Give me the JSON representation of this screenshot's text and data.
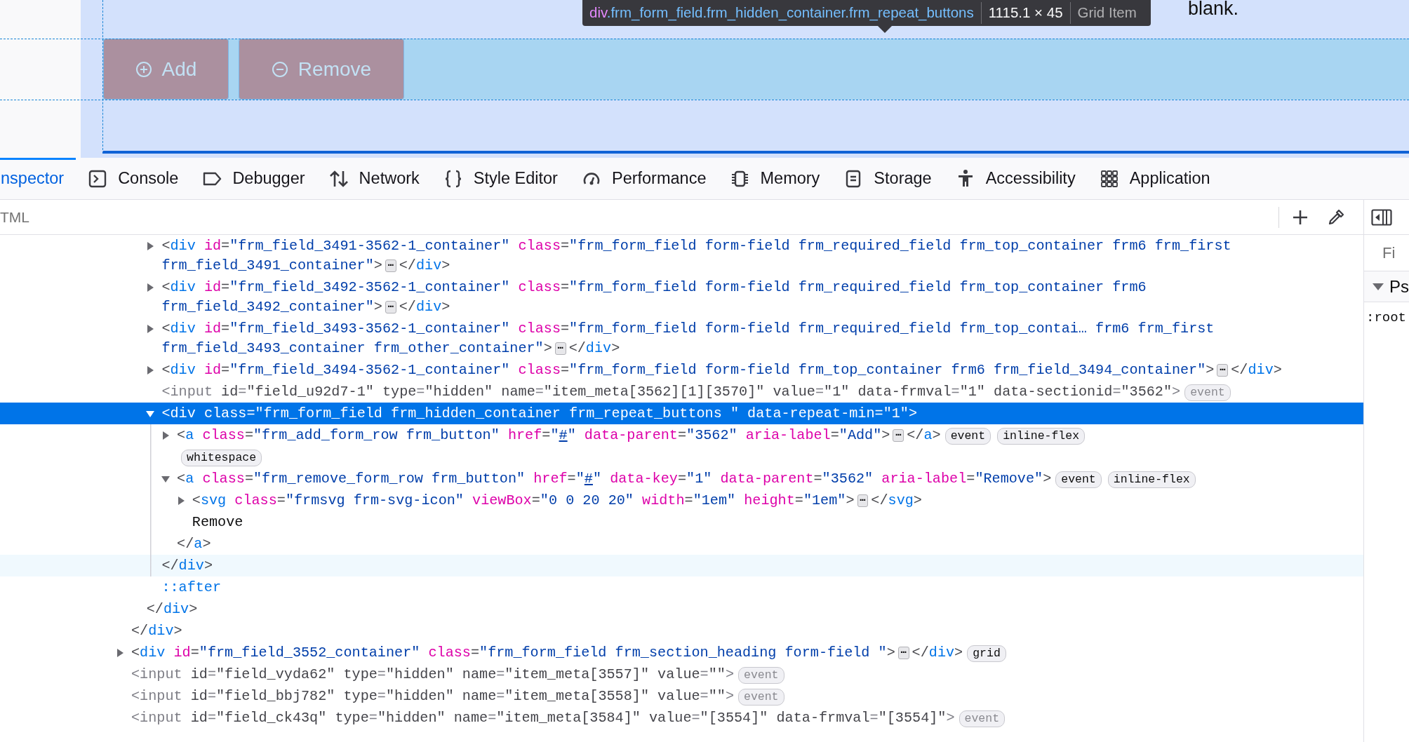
{
  "page": {
    "buttons": [
      {
        "kind": "plus",
        "label": "Add"
      },
      {
        "kind": "minus",
        "label": "Remove"
      }
    ],
    "trailing_text": "blank."
  },
  "tooltip": {
    "tag": "div",
    "classes": ".frm_form_field.frm_hidden_container.frm_repeat_buttons",
    "size": "1115.1 × 45",
    "layout": "Grid Item"
  },
  "toolbar": {
    "tabs": [
      {
        "kind": "inspector",
        "label": "nspector",
        "selected": true
      },
      {
        "kind": "console",
        "label": "Console",
        "selected": false
      },
      {
        "kind": "debugger",
        "label": "Debugger",
        "selected": false
      },
      {
        "kind": "network",
        "label": "Network",
        "selected": false
      },
      {
        "kind": "style",
        "label": "Style Editor",
        "selected": false
      },
      {
        "kind": "performance",
        "label": "Performance",
        "selected": false
      },
      {
        "kind": "memory",
        "label": "Memory",
        "selected": false
      },
      {
        "kind": "storage",
        "label": "Storage",
        "selected": false
      },
      {
        "kind": "accessibility",
        "label": "Accessibility",
        "selected": false
      },
      {
        "kind": "application",
        "label": "Application",
        "selected": false
      }
    ]
  },
  "search": {
    "placeholder": "TML"
  },
  "markup": {
    "nodes": [
      {
        "children": [
          {
            "children": [
              {
                "selected": false,
                "hovered": false,
                "hidden": false,
                "expanded": false,
                "tokens": [
                  {
                    "kind": "punct",
                    "text": "<"
                  },
                  {
                    "kind": "tag",
                    "text": "div"
                  },
                  {
                    "kind": "attr",
                    "text": " id"
                  },
                  {
                    "kind": "punct",
                    "text": "="
                  },
                  {
                    "kind": "value",
                    "text": "\"frm_field_3491-3562-1_container\""
                  },
                  {
                    "kind": "attr",
                    "text": " class"
                  },
                  {
                    "kind": "punct",
                    "text": "="
                  },
                  {
                    "kind": "value",
                    "text": "\"frm_form_field form-field frm_required_field frm_top_container frm6 frm_first frm_field_3491_container\""
                  },
                  {
                    "kind": "punct",
                    "text": ">"
                  },
                  {
                    "kind": "more",
                    "text": "⋯"
                  },
                  {
                    "kind": "punct",
                    "text": "</"
                  },
                  {
                    "kind": "tag",
                    "text": "div"
                  },
                  {
                    "kind": "punct",
                    "text": ">"
                  }
                ]
              },
              {
                "selected": false,
                "hovered": false,
                "hidden": false,
                "expanded": false,
                "tokens": [
                  {
                    "kind": "punct",
                    "text": "<"
                  },
                  {
                    "kind": "tag",
                    "text": "div"
                  },
                  {
                    "kind": "attr",
                    "text": " id"
                  },
                  {
                    "kind": "punct",
                    "text": "="
                  },
                  {
                    "kind": "value",
                    "text": "\"frm_field_3492-3562-1_container\""
                  },
                  {
                    "kind": "attr",
                    "text": " class"
                  },
                  {
                    "kind": "punct",
                    "text": "="
                  },
                  {
                    "kind": "value",
                    "text": "\"frm_form_field form-field frm_required_field frm_top_container frm6 frm_field_3492_container\""
                  },
                  {
                    "kind": "punct",
                    "text": ">"
                  },
                  {
                    "kind": "more",
                    "text": "⋯"
                  },
                  {
                    "kind": "punct",
                    "text": "</"
                  },
                  {
                    "kind": "tag",
                    "text": "div"
                  },
                  {
                    "kind": "punct",
                    "text": ">"
                  }
                ]
              },
              {
                "selected": false,
                "hovered": false,
                "hidden": false,
                "expanded": false,
                "tokens": [
                  {
                    "kind": "punct",
                    "text": "<"
                  },
                  {
                    "kind": "tag",
                    "text": "div"
                  },
                  {
                    "kind": "attr",
                    "text": " id"
                  },
                  {
                    "kind": "punct",
                    "text": "="
                  },
                  {
                    "kind": "value",
                    "text": "\"frm_field_3493-3562-1_container\""
                  },
                  {
                    "kind": "attr",
                    "text": " class"
                  },
                  {
                    "kind": "punct",
                    "text": "="
                  },
                  {
                    "kind": "value",
                    "text": "\"frm_form_field form-field frm_required_field frm_top_contai… frm6 frm_first frm_field_3493_container frm_other_container\""
                  },
                  {
                    "kind": "punct",
                    "text": ">"
                  },
                  {
                    "kind": "more",
                    "text": "⋯"
                  },
                  {
                    "kind": "punct",
                    "text": "</"
                  },
                  {
                    "kind": "tag",
                    "text": "div"
                  },
                  {
                    "kind": "punct",
                    "text": ">"
                  }
                ]
              },
              {
                "selected": false,
                "hovered": false,
                "hidden": false,
                "expanded": false,
                "tokens": [
                  {
                    "kind": "punct",
                    "text": "<"
                  },
                  {
                    "kind": "tag",
                    "text": "div"
                  },
                  {
                    "kind": "attr",
                    "text": " id"
                  },
                  {
                    "kind": "punct",
                    "text": "="
                  },
                  {
                    "kind": "value",
                    "text": "\"frm_field_3494-3562-1_container\""
                  },
                  {
                    "kind": "attr",
                    "text": " class"
                  },
                  {
                    "kind": "punct",
                    "text": "="
                  },
                  {
                    "kind": "value",
                    "text": "\"frm_form_field form-field frm_top_container frm6 frm_field_3494_container\""
                  },
                  {
                    "kind": "punct",
                    "text": ">"
                  },
                  {
                    "kind": "more",
                    "text": "⋯"
                  },
                  {
                    "kind": "punct",
                    "text": "</"
                  },
                  {
                    "kind": "tag",
                    "text": "div"
                  },
                  {
                    "kind": "punct",
                    "text": ">"
                  }
                ]
              },
              {
                "selected": false,
                "hovered": false,
                "hidden": true,
                "tokens": [
                  {
                    "kind": "punct",
                    "text": "<"
                  },
                  {
                    "kind": "tag",
                    "text": "input"
                  },
                  {
                    "kind": "attr",
                    "text": " id"
                  },
                  {
                    "kind": "punct",
                    "text": "="
                  },
                  {
                    "kind": "value",
                    "text": "\"field_u92d7-1\""
                  },
                  {
                    "kind": "attr",
                    "text": " type"
                  },
                  {
                    "kind": "punct",
                    "text": "="
                  },
                  {
                    "kind": "value",
                    "text": "\"hidden\""
                  },
                  {
                    "kind": "attr",
                    "text": " name"
                  },
                  {
                    "kind": "punct",
                    "text": "="
                  },
                  {
                    "kind": "value",
                    "text": "\"item_meta[3562][1][3570]\""
                  },
                  {
                    "kind": "attr",
                    "text": " value"
                  },
                  {
                    "kind": "punct",
                    "text": "="
                  },
                  {
                    "kind": "value",
                    "text": "\"1\""
                  },
                  {
                    "kind": "attr",
                    "text": " data-frmval"
                  },
                  {
                    "kind": "punct",
                    "text": "="
                  },
                  {
                    "kind": "value",
                    "text": "\"1\""
                  },
                  {
                    "kind": "attr",
                    "text": " data-sectionid"
                  },
                  {
                    "kind": "punct",
                    "text": "="
                  },
                  {
                    "kind": "value",
                    "text": "\"3562\""
                  },
                  {
                    "kind": "punct",
                    "text": ">"
                  },
                  {
                    "kind": "badge",
                    "text": "event"
                  }
                ]
              },
              {
                "selected": true,
                "hovered": false,
                "hidden": false,
                "expanded": true,
                "tokens": [
                  {
                    "kind": "punct",
                    "text": "<"
                  },
                  {
                    "kind": "tag",
                    "text": "div"
                  },
                  {
                    "kind": "attr",
                    "text": " class"
                  },
                  {
                    "kind": "punct",
                    "text": "="
                  },
                  {
                    "kind": "value",
                    "text": "\"frm_form_field frm_hidden_container frm_repeat_buttons \""
                  },
                  {
                    "kind": "attr",
                    "text": " data-repeat-min"
                  },
                  {
                    "kind": "punct",
                    "text": "="
                  },
                  {
                    "kind": "value",
                    "text": "\"1\""
                  },
                  {
                    "kind": "punct",
                    "text": ">"
                  }
                ],
                "children": [
                  {
                    "selected": false,
                    "hovered": false,
                    "hidden": false,
                    "expanded": false,
                    "tokens": [
                      {
                        "kind": "punct",
                        "text": "<"
                      },
                      {
                        "kind": "tag",
                        "text": "a"
                      },
                      {
                        "kind": "attr",
                        "text": " class"
                      },
                      {
                        "kind": "punct",
                        "text": "="
                      },
                      {
                        "kind": "value",
                        "text": "\"frm_add_form_row frm_button\""
                      },
                      {
                        "kind": "attr",
                        "text": " href"
                      },
                      {
                        "kind": "punct",
                        "text": "="
                      },
                      {
                        "kind": "value",
                        "text": "\""
                      },
                      {
                        "kind": "link",
                        "text": "#"
                      },
                      {
                        "kind": "value",
                        "text": "\""
                      },
                      {
                        "kind": "attr",
                        "text": " data-parent"
                      },
                      {
                        "kind": "punct",
                        "text": "="
                      },
                      {
                        "kind": "value",
                        "text": "\"3562\""
                      },
                      {
                        "kind": "attr",
                        "text": " aria-label"
                      },
                      {
                        "kind": "punct",
                        "text": "="
                      },
                      {
                        "kind": "value",
                        "text": "\"Add\""
                      },
                      {
                        "kind": "punct",
                        "text": ">"
                      },
                      {
                        "kind": "more",
                        "text": "⋯"
                      },
                      {
                        "kind": "punct",
                        "text": "</"
                      },
                      {
                        "kind": "tag",
                        "text": "a"
                      },
                      {
                        "kind": "punct",
                        "text": ">"
                      },
                      {
                        "kind": "badge",
                        "text": "event"
                      },
                      {
                        "kind": "badge",
                        "text": "inline-flex"
                      }
                    ]
                  },
                  {
                    "selected": false,
                    "hovered": false,
                    "hidden": false,
                    "tokens": [
                      {
                        "kind": "badge",
                        "text": "whitespace"
                      }
                    ]
                  },
                  {
                    "selected": false,
                    "hovered": false,
                    "hidden": false,
                    "expanded": true,
                    "tokens": [
                      {
                        "kind": "punct",
                        "text": "<"
                      },
                      {
                        "kind": "tag",
                        "text": "a"
                      },
                      {
                        "kind": "attr",
                        "text": " class"
                      },
                      {
                        "kind": "punct",
                        "text": "="
                      },
                      {
                        "kind": "value",
                        "text": "\"frm_remove_form_row frm_button\""
                      },
                      {
                        "kind": "attr",
                        "text": " href"
                      },
                      {
                        "kind": "punct",
                        "text": "="
                      },
                      {
                        "kind": "value",
                        "text": "\""
                      },
                      {
                        "kind": "link",
                        "text": "#"
                      },
                      {
                        "kind": "value",
                        "text": "\""
                      },
                      {
                        "kind": "attr",
                        "text": " data-key"
                      },
                      {
                        "kind": "punct",
                        "text": "="
                      },
                      {
                        "kind": "value",
                        "text": "\"1\""
                      },
                      {
                        "kind": "attr",
                        "text": " data-parent"
                      },
                      {
                        "kind": "punct",
                        "text": "="
                      },
                      {
                        "kind": "value",
                        "text": "\"3562\""
                      },
                      {
                        "kind": "attr",
                        "text": " aria-label"
                      },
                      {
                        "kind": "punct",
                        "text": "="
                      },
                      {
                        "kind": "value",
                        "text": "\"Remove\""
                      },
                      {
                        "kind": "punct",
                        "text": ">"
                      },
                      {
                        "kind": "badge",
                        "text": "event"
                      },
                      {
                        "kind": "badge",
                        "text": "inline-flex"
                      }
                    ],
                    "children": [
                      {
                        "selected": false,
                        "hovered": false,
                        "hidden": false,
                        "expanded": false,
                        "tokens": [
                          {
                            "kind": "punct",
                            "text": "<"
                          },
                          {
                            "kind": "tag",
                            "text": "svg"
                          },
                          {
                            "kind": "attr",
                            "text": " class"
                          },
                          {
                            "kind": "punct",
                            "text": "="
                          },
                          {
                            "kind": "value",
                            "text": "\"frmsvg frm-svg-icon\""
                          },
                          {
                            "kind": "attr",
                            "text": " viewBox"
                          },
                          {
                            "kind": "punct",
                            "text": "="
                          },
                          {
                            "kind": "value",
                            "text": "\"0 0 20 20\""
                          },
                          {
                            "kind": "attr",
                            "text": " width"
                          },
                          {
                            "kind": "punct",
                            "text": "="
                          },
                          {
                            "kind": "value",
                            "text": "\"1em\""
                          },
                          {
                            "kind": "attr",
                            "text": " height"
                          },
                          {
                            "kind": "punct",
                            "text": "="
                          },
                          {
                            "kind": "value",
                            "text": "\"1em\""
                          },
                          {
                            "kind": "punct",
                            "text": ">"
                          },
                          {
                            "kind": "more",
                            "text": "⋯"
                          },
                          {
                            "kind": "punct",
                            "text": "</"
                          },
                          {
                            "kind": "tag",
                            "text": "svg"
                          },
                          {
                            "kind": "punct",
                            "text": ">"
                          }
                        ]
                      },
                      {
                        "selected": false,
                        "hovered": false,
                        "hidden": false,
                        "tokens": [
                          {
                            "kind": "text",
                            "text": "Remove"
                          }
                        ]
                      }
                    ],
                    "close": {
                      "hovered": false,
                      "tokens": [
                        {
                          "kind": "punct",
                          "text": "</"
                        },
                        {
                          "kind": "tag",
                          "text": "a"
                        },
                        {
                          "kind": "punct",
                          "text": ">"
                        }
                      ]
                    }
                  }
                ],
                "close": {
                  "hovered": true,
                  "tokens": [
                    {
                      "kind": "punct",
                      "text": "</"
                    },
                    {
                      "kind": "tag",
                      "text": "div"
                    },
                    {
                      "kind": "punct",
                      "text": ">"
                    }
                  ]
                }
              },
              {
                "selected": false,
                "hovered": false,
                "hidden": false,
                "tokens": [
                  {
                    "kind": "pseudo",
                    "text": "::after"
                  }
                ]
              }
            ],
            "close": {
              "hovered": false,
              "tokens": [
                {
                  "kind": "punct",
                  "text": "</"
                },
                {
                  "kind": "tag",
                  "text": "div"
                },
                {
                  "kind": "punct",
                  "text": ">"
                }
              ]
            }
          }
        ],
        "close": {
          "hovered": false,
          "tokens": [
            {
              "kind": "punct",
              "text": "</"
            },
            {
              "kind": "tag",
              "text": "div"
            },
            {
              "kind": "punct",
              "text": ">"
            }
          ]
        }
      },
      {
        "selected": false,
        "hovered": false,
        "hidden": false,
        "expanded": false,
        "tokens": [
          {
            "kind": "punct",
            "text": "<"
          },
          {
            "kind": "tag",
            "text": "div"
          },
          {
            "kind": "attr",
            "text": " id"
          },
          {
            "kind": "punct",
            "text": "="
          },
          {
            "kind": "value",
            "text": "\"frm_field_3552_container\""
          },
          {
            "kind": "attr",
            "text": " class"
          },
          {
            "kind": "punct",
            "text": "="
          },
          {
            "kind": "value",
            "text": "\"frm_form_field frm_section_heading form-field \""
          },
          {
            "kind": "punct",
            "text": ">"
          },
          {
            "kind": "more",
            "text": "⋯"
          },
          {
            "kind": "punct",
            "text": "</"
          },
          {
            "kind": "tag",
            "text": "div"
          },
          {
            "kind": "punct",
            "text": ">"
          },
          {
            "kind": "badge",
            "text": "grid"
          }
        ]
      },
      {
        "selected": false,
        "hovered": false,
        "hidden": true,
        "tokens": [
          {
            "kind": "punct",
            "text": "<"
          },
          {
            "kind": "tag",
            "text": "input"
          },
          {
            "kind": "attr",
            "text": " id"
          },
          {
            "kind": "punct",
            "text": "="
          },
          {
            "kind": "value",
            "text": "\"field_vyda62\""
          },
          {
            "kind": "attr",
            "text": " type"
          },
          {
            "kind": "punct",
            "text": "="
          },
          {
            "kind": "value",
            "text": "\"hidden\""
          },
          {
            "kind": "attr",
            "text": " name"
          },
          {
            "kind": "punct",
            "text": "="
          },
          {
            "kind": "value",
            "text": "\"item_meta[3557]\""
          },
          {
            "kind": "attr",
            "text": " value"
          },
          {
            "kind": "punct",
            "text": "="
          },
          {
            "kind": "value",
            "text": "\"\""
          },
          {
            "kind": "punct",
            "text": ">"
          },
          {
            "kind": "badge",
            "text": "event"
          }
        ]
      },
      {
        "selected": false,
        "hovered": false,
        "hidden": true,
        "tokens": [
          {
            "kind": "punct",
            "text": "<"
          },
          {
            "kind": "tag",
            "text": "input"
          },
          {
            "kind": "attr",
            "text": " id"
          },
          {
            "kind": "punct",
            "text": "="
          },
          {
            "kind": "value",
            "text": "\"field_bbj782\""
          },
          {
            "kind": "attr",
            "text": " type"
          },
          {
            "kind": "punct",
            "text": "="
          },
          {
            "kind": "value",
            "text": "\"hidden\""
          },
          {
            "kind": "attr",
            "text": " name"
          },
          {
            "kind": "punct",
            "text": "="
          },
          {
            "kind": "value",
            "text": "\"item_meta[3558]\""
          },
          {
            "kind": "attr",
            "text": " value"
          },
          {
            "kind": "punct",
            "text": "="
          },
          {
            "kind": "value",
            "text": "\"\""
          },
          {
            "kind": "punct",
            "text": ">"
          },
          {
            "kind": "badge",
            "text": "event"
          }
        ]
      },
      {
        "selected": false,
        "hovered": false,
        "hidden": true,
        "tokens": [
          {
            "kind": "punct",
            "text": "<"
          },
          {
            "kind": "tag",
            "text": "input"
          },
          {
            "kind": "attr",
            "text": " id"
          },
          {
            "kind": "punct",
            "text": "="
          },
          {
            "kind": "value",
            "text": "\"field_ck43q\""
          },
          {
            "kind": "attr",
            "text": " type"
          },
          {
            "kind": "punct",
            "text": "="
          },
          {
            "kind": "value",
            "text": "\"hidden\""
          },
          {
            "kind": "attr",
            "text": " name"
          },
          {
            "kind": "punct",
            "text": "="
          },
          {
            "kind": "value",
            "text": "\"item_meta[3584]\""
          },
          {
            "kind": "attr",
            "text": " value"
          },
          {
            "kind": "punct",
            "text": "="
          },
          {
            "kind": "value",
            "text": "\"[3554]\""
          },
          {
            "kind": "attr",
            "text": " data-frmval"
          },
          {
            "kind": "punct",
            "text": "="
          },
          {
            "kind": "value",
            "text": "\"[3554]\""
          },
          {
            "kind": "punct",
            "text": ">"
          },
          {
            "kind": "badge",
            "text": "event"
          }
        ]
      }
    ]
  },
  "sidebar": {
    "filter_placeholder": "Fi",
    "section": {
      "label": "Ps",
      "expanded": true
    },
    "rule": ":root"
  }
}
